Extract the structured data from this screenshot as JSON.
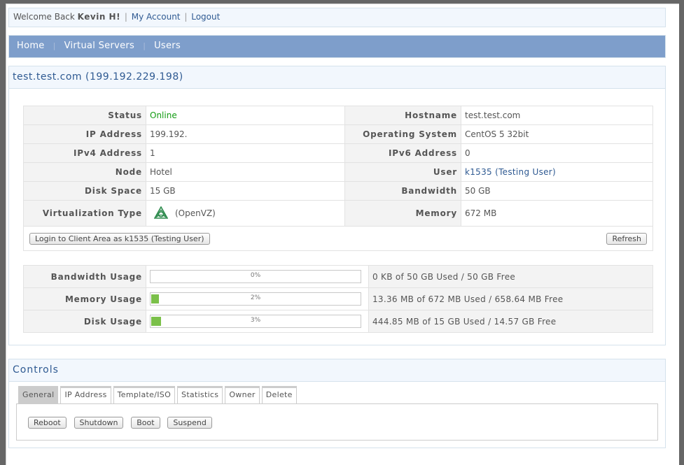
{
  "topbar": {
    "welcome_prefix": "Welcome Back",
    "username": "Kevin H!",
    "separator": "|",
    "links": [
      "My Account",
      "Logout"
    ]
  },
  "nav": {
    "separator": "|",
    "items": [
      "Home",
      "Virtual Servers",
      "Users"
    ]
  },
  "server": {
    "title": "test.test.com (199.192.229.198)",
    "left_rows": [
      {
        "label": "Status",
        "value": "Online"
      },
      {
        "label": "IP Address",
        "value": "199.192."
      },
      {
        "label": "IPv4 Address",
        "value": "1"
      },
      {
        "label": "Node",
        "value": "Hotel"
      },
      {
        "label": "Disk Space",
        "value": "15 GB"
      },
      {
        "label": "Virtualization Type",
        "value": "(OpenVZ)",
        "icon": "openvz-icon"
      }
    ],
    "right_rows": [
      {
        "label": "Hostname",
        "value": "test.test.com"
      },
      {
        "label": "Operating System",
        "value": "CentOS 5 32bit"
      },
      {
        "label": "IPv6 Address",
        "value": "0"
      },
      {
        "label": "User",
        "value": "k1535 (Testing User)"
      },
      {
        "label": "Bandwidth",
        "value": "50 GB"
      },
      {
        "label": "Memory",
        "value": "672 MB"
      }
    ],
    "login_button": "Login to Client Area as k1535 (Testing User)",
    "refresh_button": "Refresh",
    "status_color": "#139c13",
    "usage": [
      {
        "label": "Bandwidth Usage",
        "percent": 0,
        "percent_text": "0%",
        "detail": "0 KB of 50 GB Used / 50 GB Free"
      },
      {
        "label": "Memory Usage",
        "percent": 2,
        "percent_text": "2%",
        "detail": "13.36 MB of 672 MB Used / 658.64 MB Free"
      },
      {
        "label": "Disk Usage",
        "percent": 3,
        "percent_text": "3%",
        "detail": "444.85 MB of 15 GB Used / 14.57 GB Free"
      }
    ],
    "bar_color": "#7bc04a"
  },
  "controls": {
    "title": "Controls",
    "tabs": [
      "General",
      "IP Address",
      "Template/ISO",
      "Statistics",
      "Owner",
      "Delete"
    ],
    "active_tab": "General",
    "buttons": [
      "Reboot",
      "Shutdown",
      "Boot",
      "Suspend"
    ]
  }
}
